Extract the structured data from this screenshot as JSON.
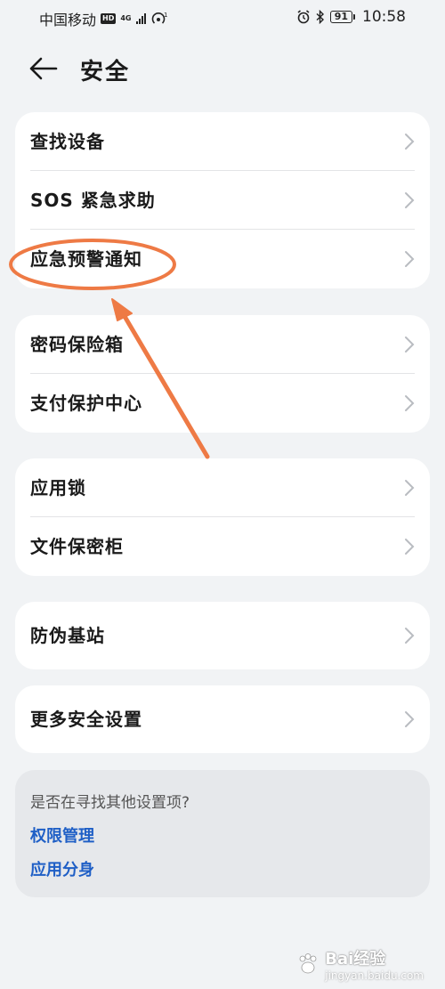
{
  "status_bar": {
    "carrier": "中国移动",
    "hd_badge": "HD",
    "network": "4G",
    "battery": "91",
    "time": "10:58"
  },
  "header": {
    "title": "安全",
    "back_icon": "arrow-left-icon"
  },
  "groups": [
    {
      "items": [
        {
          "label": "查找设备"
        },
        {
          "label": "SOS 紧急求助"
        },
        {
          "label": "应急预警通知"
        }
      ]
    },
    {
      "items": [
        {
          "label": "密码保险箱"
        },
        {
          "label": "支付保护中心"
        }
      ]
    },
    {
      "items": [
        {
          "label": "应用锁"
        },
        {
          "label": "文件保密柜"
        }
      ]
    },
    {
      "items": [
        {
          "label": "防伪基站"
        }
      ]
    },
    {
      "items": [
        {
          "label": "更多安全设置"
        }
      ]
    }
  ],
  "suggestions": {
    "question": "是否在寻找其他设置项?",
    "links": [
      "权限管理",
      "应用分身"
    ]
  },
  "watermark": {
    "text": "Bai经验",
    "sub": "jingyan.baidu.com"
  },
  "colors": {
    "background": "#f1f3f5",
    "card": "#ffffff",
    "link": "#1f5fc6",
    "annotation": "#ee7a45"
  }
}
